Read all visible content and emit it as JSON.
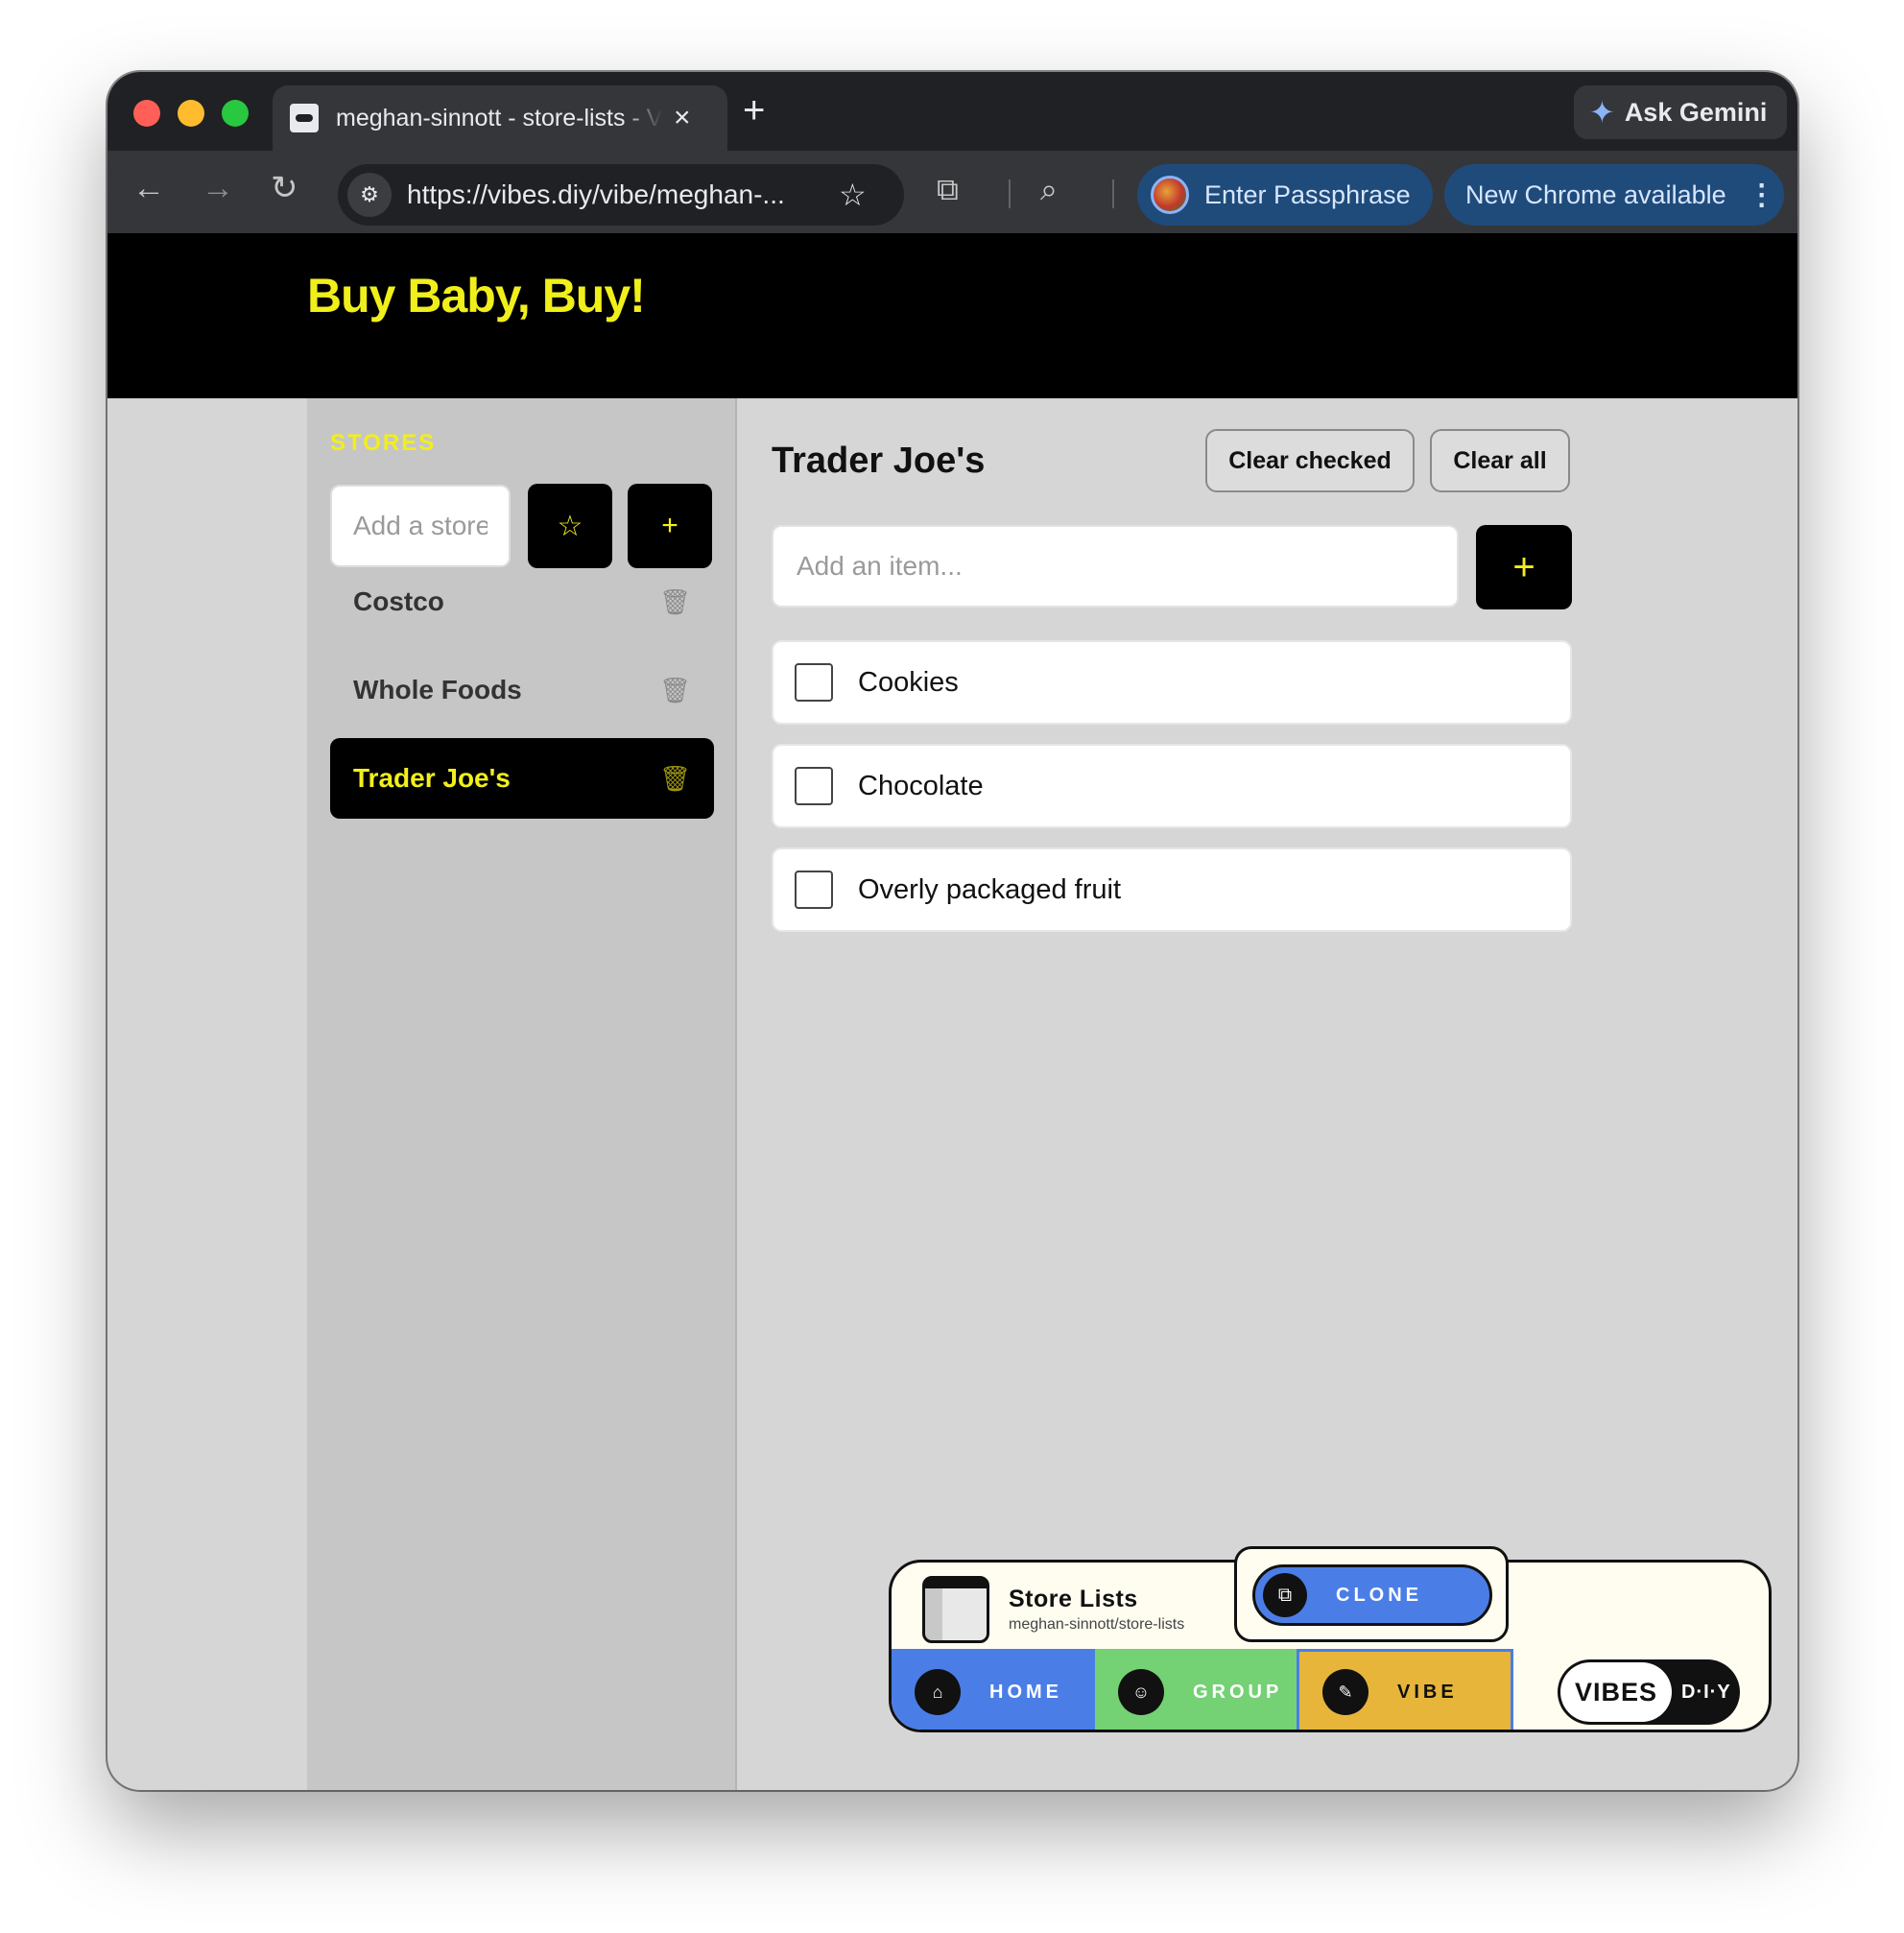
{
  "browser": {
    "tab_title": "meghan-sinnott - store-lists - Vibes DIY",
    "tab_close": "×",
    "new_tab": "+",
    "gemini_label": "Ask Gemini",
    "url": "https://vibes.diy/vibe/meghan-...",
    "passphrase_label": "Enter Passphrase",
    "update_label": "New Chrome available"
  },
  "app": {
    "title": "Buy Baby, Buy!",
    "stores_heading": "STORES",
    "store_input_placeholder": "Add a store...",
    "star_button": "☆",
    "add_store_button": "+",
    "stores": [
      {
        "name": "Costco",
        "active": false
      },
      {
        "name": "Whole Foods",
        "active": false
      },
      {
        "name": "Trader Joe's",
        "active": true
      }
    ],
    "list": {
      "title": "Trader Joe's",
      "clear_checked": "Clear checked",
      "clear_all": "Clear all",
      "item_placeholder": "Add an item...",
      "add_item_button": "+",
      "items": [
        {
          "label": "Cookies",
          "checked": false
        },
        {
          "label": "Chocolate",
          "checked": false
        },
        {
          "label": "Overly packaged fruit",
          "checked": false
        }
      ]
    }
  },
  "vibes_widget": {
    "app_name": "Store Lists",
    "app_path": "meghan-sinnott/store-lists",
    "clone_label": "CLONE",
    "nav": {
      "home": "HOME",
      "group": "GROUP",
      "vibe": "VIBE"
    },
    "logo_left": "VIBES",
    "logo_right": "D·I·Y"
  },
  "colors": {
    "accent_yellow": "#f1ef1a",
    "home_blue": "#4a7ee6",
    "group_green": "#74d174",
    "vibe_gold": "#e6b53a"
  }
}
